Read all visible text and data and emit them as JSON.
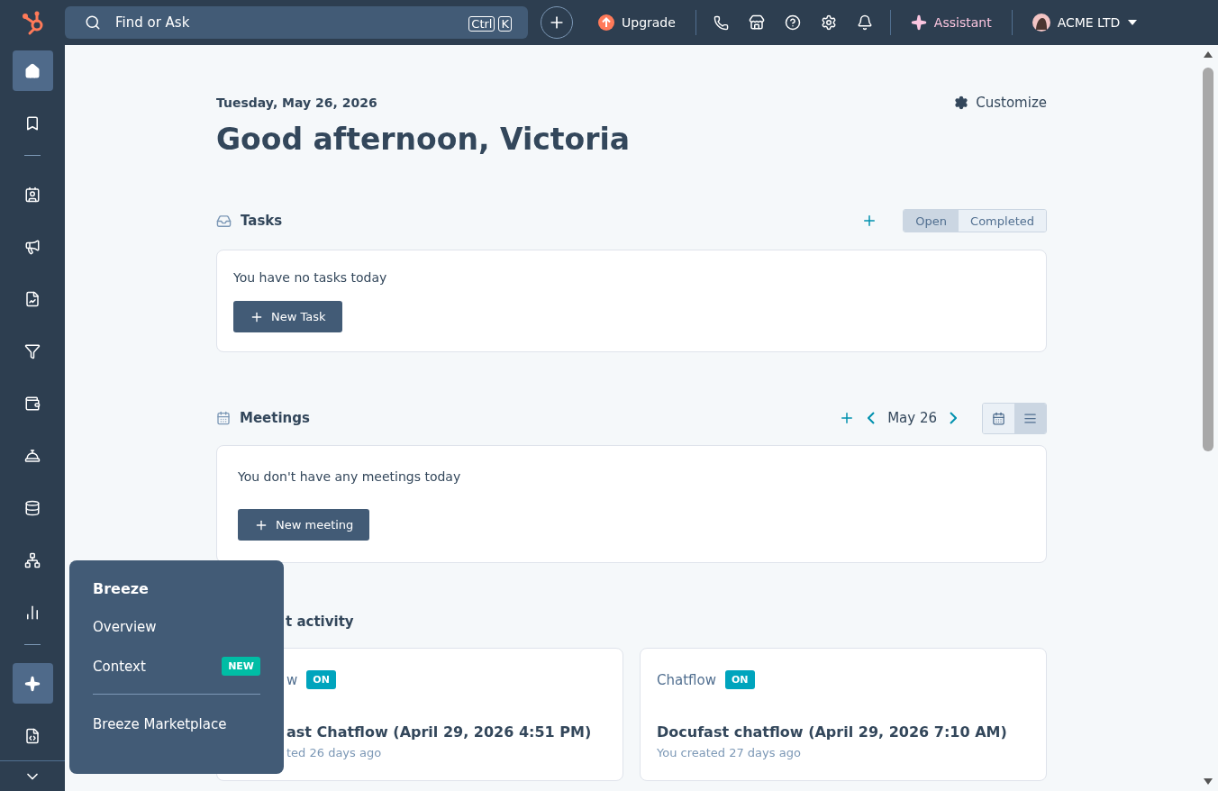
{
  "top_bar": {
    "search": {
      "placeholder": "Find or Ask",
      "shortcut": [
        "Ctrl",
        "K"
      ]
    },
    "upgrade": "Upgrade",
    "assistant": "Assistant",
    "account": "ACME LTD"
  },
  "sidebar": {
    "items": [
      {
        "selected": true
      },
      {
        "selected": false
      },
      {
        "kind": "divider"
      },
      {
        "selected": false
      },
      {
        "selected": false
      },
      {
        "selected": false
      },
      {
        "selected": false
      },
      {
        "selected": false
      },
      {
        "selected": false
      },
      {
        "selected": false
      },
      {
        "selected": false
      },
      {
        "selected": false
      },
      {
        "kind": "divider"
      },
      {
        "selected": true
      },
      {
        "selected": false
      }
    ]
  },
  "header": {
    "date": "Tuesday, May 26, 2026",
    "greeting": "Good afternoon, Victoria",
    "customize": "Customize"
  },
  "tasks": {
    "title": "Tasks",
    "filters": [
      {
        "label": "Open",
        "selected": true
      },
      {
        "label": "Completed",
        "selected": false
      }
    ],
    "empty": "You have no tasks today",
    "button": "New Task"
  },
  "meetings": {
    "title": "Meetings",
    "date": "May 26",
    "views": [
      {
        "selected": false
      },
      {
        "selected": true
      }
    ],
    "empty": "You don't have any meetings today",
    "button": "New meeting"
  },
  "activity": {
    "title": "t activity",
    "clipped": true,
    "cards": [
      {
        "type": "w",
        "status": "ON",
        "title": "ast Chatflow (April 29, 2026 4:51 PM)",
        "meta": "ted 26 days ago",
        "clipped": true
      },
      {
        "type": "Chatflow",
        "status": "ON",
        "title": "Docufast chatflow (April 29, 2026 7:10 AM)",
        "meta": "You created 27 days ago",
        "clipped": false
      }
    ]
  },
  "popover": {
    "title": "Breeze",
    "items": [
      {
        "label": "Overview"
      },
      {
        "label": "Context",
        "badge": "NEW"
      },
      {
        "kind": "divider"
      },
      {
        "label": "Breeze Marketplace"
      }
    ]
  }
}
